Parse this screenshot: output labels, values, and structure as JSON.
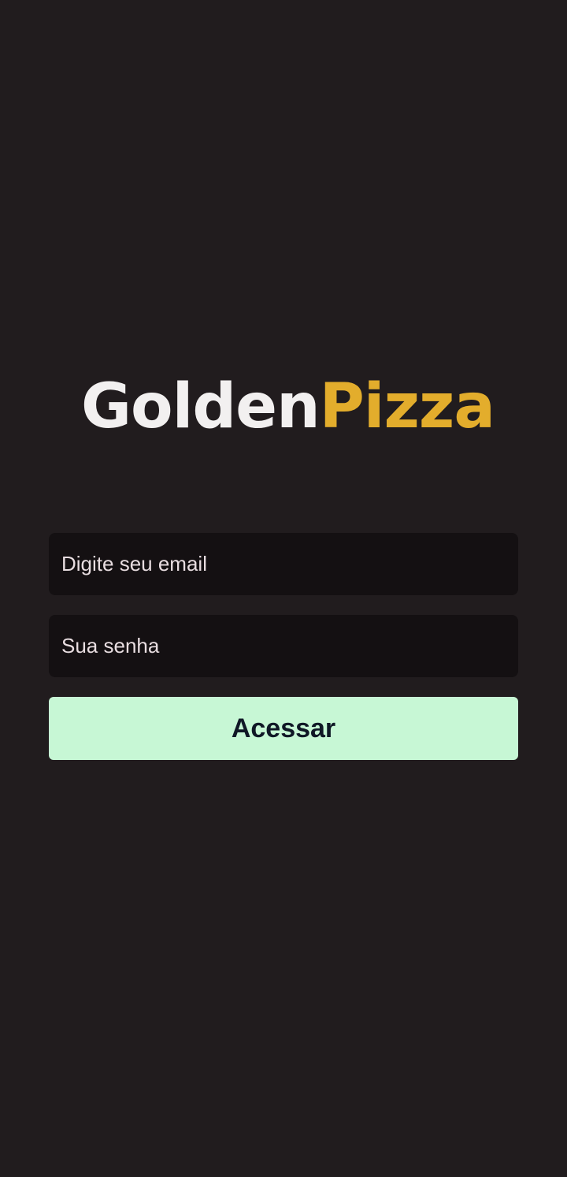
{
  "logo": {
    "part1": "Golden",
    "part2": "Pizza",
    "colors": {
      "part1": "#f2f0f0",
      "part2": "#e3ad2c"
    }
  },
  "login": {
    "email_placeholder": "Digite seu email",
    "email_value": "",
    "password_placeholder": "Sua senha",
    "password_value": "",
    "submit_label": "Acessar"
  },
  "colors": {
    "background": "#211c1e",
    "input_background": "#141012",
    "button_background": "#c7f7d5",
    "button_text": "#101826"
  }
}
